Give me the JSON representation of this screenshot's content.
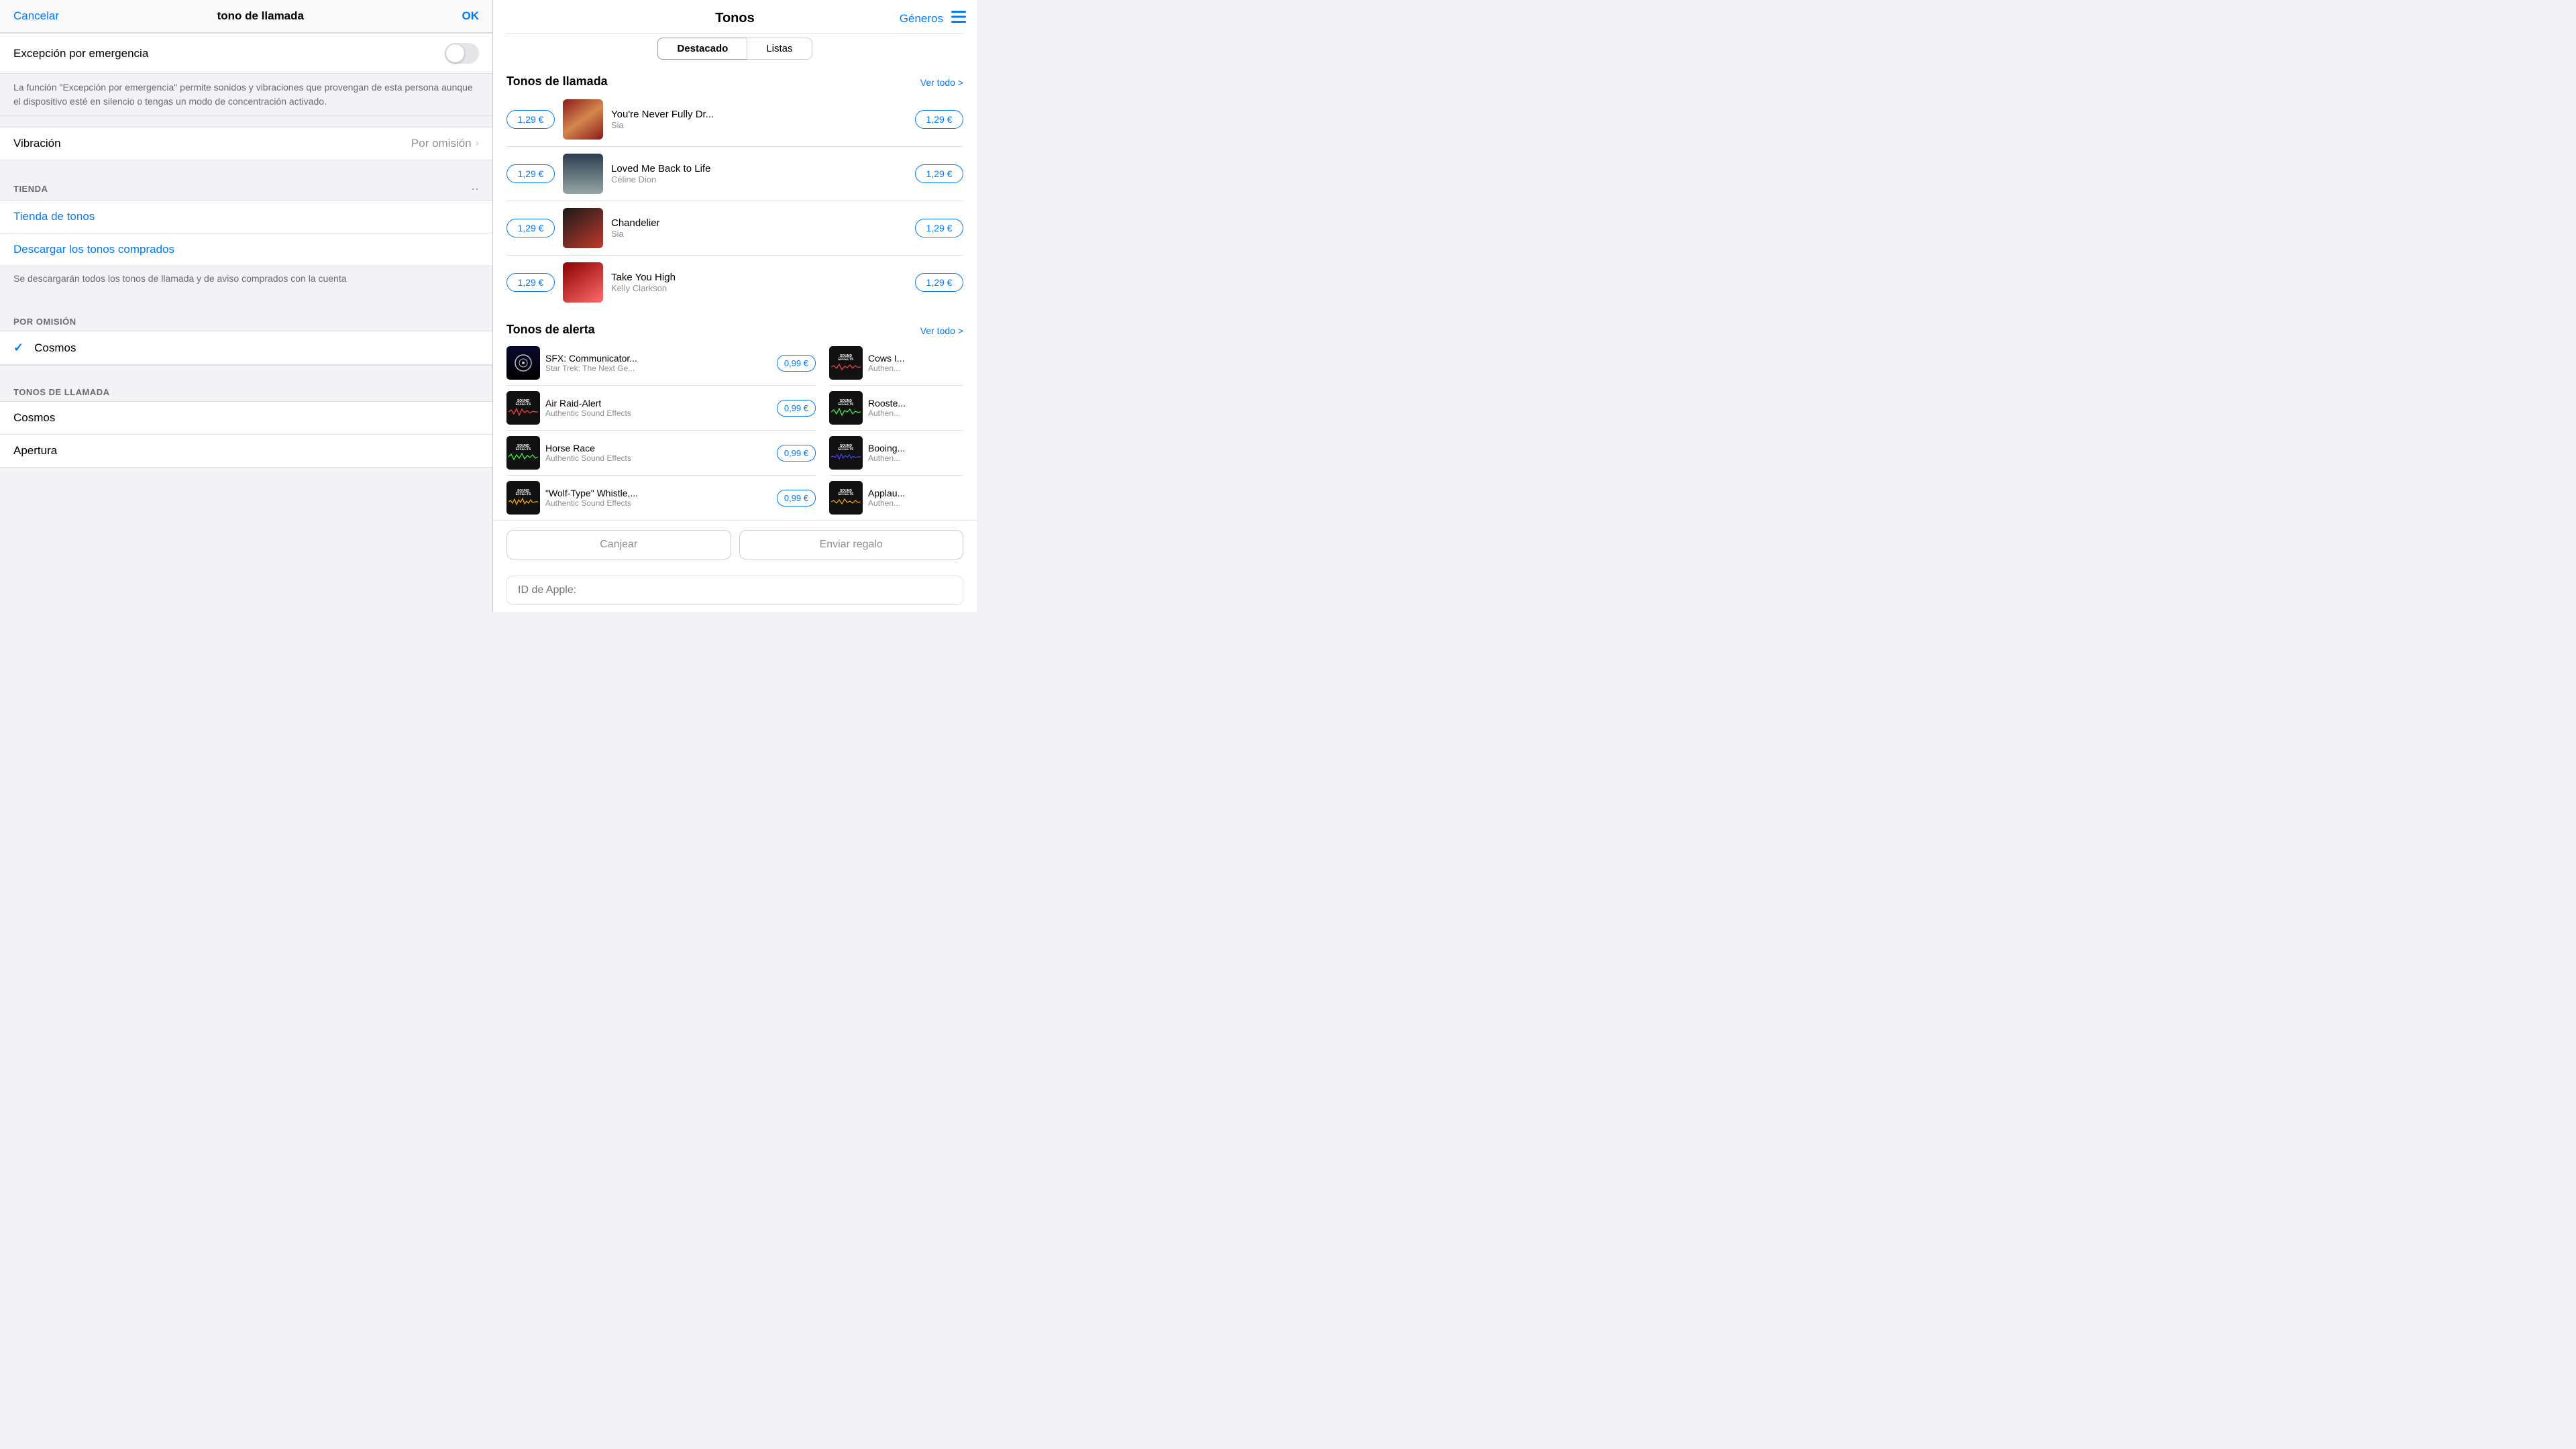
{
  "left": {
    "topBar": {
      "cancel": "Cancelar",
      "title": "tono de llamada",
      "ok": "OK"
    },
    "emergencia": {
      "label": "Excepción por emergencia",
      "description": "La función \"Excepción por emergencia\" permite sonidos y vibraciones que provengan de esta persona aunque el dispositivo esté en silencio o tengas un modo de concentración activado."
    },
    "vibracion": {
      "label": "Vibración",
      "value": "Por omisión"
    },
    "tiendaSection": "TIENDA",
    "tiendaTonos": "Tienda de tonos",
    "descargar": "Descargar los tonos comprados",
    "descargarDesc": "Se descargarán todos los tonos de llamada y de aviso comprados con la cuenta",
    "porOmision": "POR OMISIÓN",
    "cosmosCheck": "Cosmos",
    "tonosDeLlamada": "TONOS DE LLAMADA",
    "ringtones": [
      "Cosmos",
      "Apertura"
    ]
  },
  "right": {
    "title": "Tonos",
    "generos": "Géneros",
    "tabs": [
      "Destacado",
      "Listas"
    ],
    "activeTab": 0,
    "tonosDeLlamada": {
      "title": "Tonos de llamada",
      "verTodo": "Ver todo >",
      "items": [
        {
          "price": "1,29 €",
          "name": "You're Never Fully Dr...",
          "artist": "Sia",
          "artStyle": "annie"
        },
        {
          "price": "1,29 €",
          "name": "Loved Me Back to Life",
          "artist": "Céline Dion",
          "artStyle": "celine"
        },
        {
          "price": "1,29 €",
          "name": "Chandelier",
          "artist": "Sia",
          "artStyle": "sia"
        },
        {
          "price": "1,29 €",
          "name": "Take You High",
          "artist": "Kelly Clarkson",
          "artStyle": "kelly"
        }
      ]
    },
    "tonosDeAlerta": {
      "title": "Tonos de alerta",
      "verTodo": "Ver todo >",
      "leftItems": [
        {
          "price": "0,99 €",
          "name": "SFX: Communicator...",
          "artist": "Star Trek: The Next Ge...",
          "artStyle": "sfx-communicator"
        },
        {
          "price": "0,99 €",
          "name": "Air Raid-Alert",
          "artist": "Authentic Sound Effects",
          "artStyle": "sfx-dark"
        },
        {
          "price": "0,99 €",
          "name": "Horse Race",
          "artist": "Authentic Sound Effects",
          "artStyle": "sfx-dark2"
        },
        {
          "price": "0,99 €",
          "name": "\"Wolf-Type\" Whistle,...",
          "artist": "Authentic Sound Effects",
          "artStyle": "sfx-dark3"
        }
      ],
      "rightItems": [
        {
          "name": "Cows I...",
          "artist": "Authen...",
          "artStyle": "sfx-dark4"
        },
        {
          "name": "Rooste...",
          "artist": "Authen...",
          "artStyle": "sfx-dark5"
        },
        {
          "name": "Booing...",
          "artist": "Authen...",
          "artStyle": "sfx-dark6"
        },
        {
          "name": "Applau...",
          "artist": "Authen...",
          "artStyle": "sfx-dark7"
        }
      ]
    },
    "bottomActions": {
      "canjear": "Canjear",
      "enviarRegalo": "Enviar regalo"
    },
    "appleId": {
      "placeholder": "ID de Apple:"
    }
  }
}
